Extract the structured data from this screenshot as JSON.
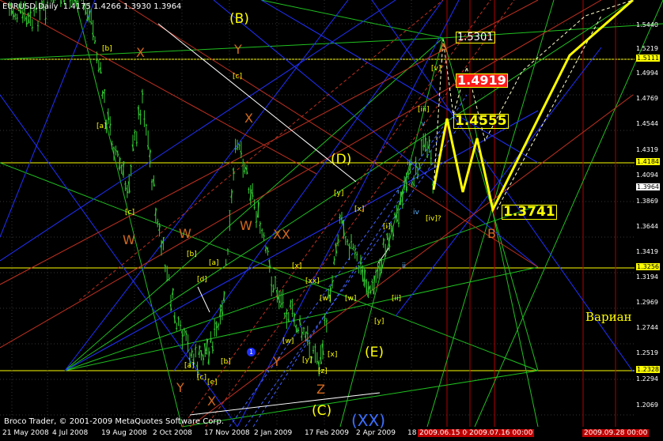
{
  "header": {
    "symbol": "EURUSD,Daily",
    "ohlc": "1.4175 1.4266 1.3930 1.3964"
  },
  "copyright": "Broco Trader, © 2001-2009 MetaQuotes Software Corp.",
  "x_axis": {
    "ticks": [
      "21 May 2008",
      "4 Jul 2008",
      "19 Aug 2008",
      "2 Oct 2008",
      "17 Nov 2008",
      "2 Jan 2009",
      "17 Feb 2009",
      "2 Apr 2009",
      "18"
    ],
    "red_ticks": [
      "2009.06.15 00:00",
      "2009.07.16 00:00",
      "2009.09.28 00:00"
    ]
  },
  "y_axis": {
    "ticks": [
      "1.5440",
      "1.5219",
      "1.4994",
      "1.4769",
      "1.4544",
      "1.4319",
      "1.4094",
      "1.3869",
      "1.3644",
      "1.3419",
      "1.3194",
      "1.2969",
      "1.2744",
      "1.2519",
      "1.2294",
      "1.2069"
    ],
    "badges": [
      {
        "text": "1.5111",
        "color": "#ffff00"
      },
      {
        "text": "1.4184",
        "color": "#ffff00"
      },
      {
        "text": "1.3964",
        "color": "#ffffff"
      },
      {
        "text": "1.3256",
        "color": "#ffff00"
      },
      {
        "text": "1.2328",
        "color": "#ffff00"
      }
    ]
  },
  "price_labels": {
    "p1": "1.5301",
    "p2": "1.4919",
    "p3": "1.4555",
    "p4": "1.3741"
  },
  "wave_labels": {
    "B_top": "(B)",
    "D": "(D)",
    "E": "(E)",
    "C": "(C)",
    "XX_bottom": "(XX)",
    "X1": "X",
    "Y1": "Y",
    "X2": "X",
    "W1": "W",
    "W2": "W",
    "W3": "W",
    "XX": "XX",
    "Y2": "Y",
    "Y3": "Y",
    "X3": "X",
    "Z": "Z",
    "A": "A",
    "B": "B",
    "blue1": "1",
    "bk_b1": "[b]",
    "bk_c1": "[c]",
    "bk_a1": "[a]",
    "bk_c2": "[c]",
    "bk_b2": "[b]",
    "bk_a2": "[a]",
    "bk_d": "[d]",
    "bk_b3": "[b]",
    "bk_a3": "[a]",
    "bk_c3": "[c]",
    "bk_e": "[e]",
    "bk_x1": "[x]",
    "bk_xx": "[xx]",
    "bk_w1": "[w]",
    "bk_y1": "[y]",
    "bk_z": "[z]",
    "bk_x2": "[x]",
    "bk_w2": "[w]",
    "bk_w3": "[w]",
    "bk_y2": "[y]",
    "bk_x3": "[x]",
    "bk_x4": "[x]",
    "bk_i": "[i]",
    "bk_ii": "[ii]",
    "bk_y3": "[y]",
    "bk_v": "[v]",
    "bk_iii": "[iii]",
    "bk_iv": "[iv]?",
    "c_i": "i",
    "c_ii": "ii",
    "c_iii": "iii",
    "c_iv": "iv",
    "c_v": "v"
  },
  "side_text": "Вариан",
  "colors": {
    "candle": "#33cc33",
    "yellow": "#ffff00",
    "orange": "#d2691e",
    "red_box": "#ff2020",
    "blue": "#2030ff",
    "green": "#20c020"
  }
}
